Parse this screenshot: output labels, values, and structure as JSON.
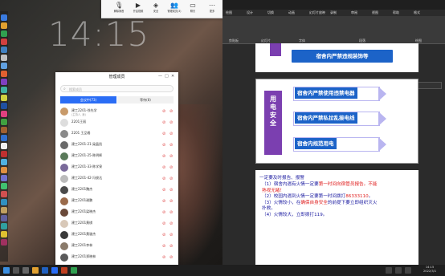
{
  "desktop": {
    "clock": "14:15"
  },
  "meeting_toolbar": {
    "buttons": [
      {
        "label": "解除静音",
        "icon": "mic-icon"
      },
      {
        "label": "开启视频",
        "icon": "camera-icon"
      },
      {
        "label": "安全",
        "icon": "shield-icon"
      },
      {
        "label": "管理成员(3)",
        "icon": "members-icon"
      },
      {
        "label": "聊天",
        "icon": "chat-icon"
      },
      {
        "label": "更多",
        "icon": "more-icon"
      },
      {
        "label": "共享屏幕",
        "icon": "share-screen-icon"
      },
      {
        "label": "互动批注",
        "icon": "annotate-icon"
      },
      {
        "label": "视频会议",
        "icon": "video-icon"
      },
      {
        "label": "结束共享",
        "icon": "stop-share-icon"
      }
    ],
    "leave_label": "结束共享"
  },
  "member_panel": {
    "title": "管理成员",
    "search_placeholder": "搜索成员",
    "tabs": [
      "会议中(73)",
      "等待(8)"
    ],
    "members": [
      {
        "name": "建工2201-徐先学",
        "sub": "(主持人, 我)",
        "color": "#c89a6a"
      },
      {
        "name": "2201王丽",
        "sub": "",
        "color": "#ddd"
      },
      {
        "name": "2201 王品格",
        "sub": "",
        "color": "#8a8a8a"
      },
      {
        "name": "建工2201-21-梁晶凯",
        "sub": "",
        "color": "#6a6a6a"
      },
      {
        "name": "建工2201-25-陈明辉",
        "sub": "",
        "color": "#5a7a5a"
      },
      {
        "name": "建工2201-33-陈学泉",
        "sub": "",
        "color": "#7a6a9a"
      },
      {
        "name": "建工2201-42-冯俊达",
        "sub": "",
        "color": "#bbb"
      },
      {
        "name": "建工2201魏杰",
        "sub": "",
        "color": "#4a4a4a"
      },
      {
        "name": "建工2201谢鹏",
        "sub": "",
        "color": "#9a6a4a"
      },
      {
        "name": "建工2201梁晓杰",
        "sub": "",
        "color": "#6a4a3a"
      },
      {
        "name": "建工2201黄棋",
        "sub": "",
        "color": "#d8c8b8"
      },
      {
        "name": "建工2201黄骏杰",
        "sub": "",
        "color": "#3a3a3a"
      },
      {
        "name": "建工2201李林",
        "sub": "",
        "color": "#8a7a6a"
      },
      {
        "name": "建工2201郑晓林",
        "sub": "",
        "color": "#5a5a5a"
      },
      {
        "name": "建工2201吴东辰",
        "sub": "",
        "color": "#aa9a8a"
      }
    ]
  },
  "ppt": {
    "tabs": [
      "绘图",
      "设计",
      "切换",
      "动画",
      "幻灯片放映",
      "录制",
      "审阅",
      "视图",
      "帮助",
      "格式"
    ],
    "groups": [
      "剪贴板",
      "幻灯片",
      "字体",
      "段落",
      "绘图"
    ],
    "popup_label": "比赛展示",
    "slide1": {
      "banner": "宿舍内严禁违规装饰等"
    },
    "slide2": {
      "vertical_title": "用电安全",
      "items": [
        "宿舍内严禁使用违禁电器",
        "宿舍内严禁私拉乱接电线",
        "宿舍内规范用电"
      ]
    },
    "slide3": {
      "heading": "一定要及时报告、报警",
      "lines": [
        {
          "pre": "（1）宿舍内遇有火情一定要",
          "red": "第一时间向宿管员报告。不能",
          "post": ""
        },
        {
          "pre": "",
          "red": "熟视无睹！",
          "post": ""
        },
        {
          "pre": "（2）校园内遇到火情一定要第一时间拨打",
          "red": "86333110",
          "post": "。"
        },
        {
          "pre": "（3）火情较小，在",
          "red": "确保自身安全",
          "post": "的前提下要立即组织灭火"
        },
        {
          "pre": "扑救。",
          "red": "",
          "post": ""
        },
        {
          "pre": "（4）火情较大，立即拨打119。",
          "red": "",
          "post": ""
        }
      ]
    }
  },
  "taskbar": {
    "time": "14:15",
    "date": "2022/3/1"
  },
  "colors": {
    "accent_blue": "#2a6df5",
    "slide_blue": "#1c63c8",
    "slide_purple": "#7b3fb0",
    "alert_red": "#e02020"
  }
}
